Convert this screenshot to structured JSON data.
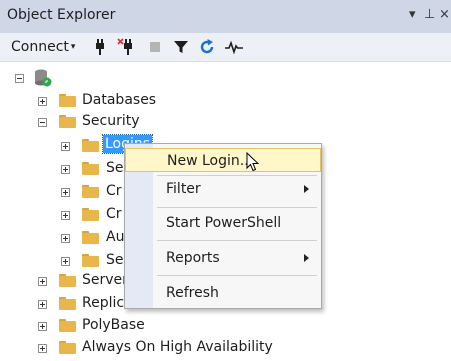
{
  "window": {
    "title": "Object Explorer",
    "dropdown_glyph": "▾",
    "pin_glyph": "⊥",
    "close_glyph": "×"
  },
  "toolbar": {
    "connect_label": "Connect",
    "connect_arrow": "▾",
    "icons": [
      "connect-plug-icon",
      "disconnect-plug-icon",
      "stop-icon",
      "filter-icon",
      "refresh-icon",
      "activity-monitor-icon"
    ]
  },
  "tree": {
    "items": [
      {
        "label": "Databases"
      },
      {
        "label": "Security"
      },
      {
        "label": "Logins"
      },
      {
        "label": "Se"
      },
      {
        "label": "Cr"
      },
      {
        "label": "Cr"
      },
      {
        "label": "Au"
      },
      {
        "label": "Se"
      },
      {
        "label": "Server"
      },
      {
        "label": "Replic"
      },
      {
        "label": "PolyBase"
      },
      {
        "label": "Always On High Availability"
      }
    ]
  },
  "context_menu": {
    "items": [
      {
        "label": "New Login..."
      },
      {
        "label": "Filter"
      },
      {
        "label": "Start PowerShell"
      },
      {
        "label": "Reports"
      },
      {
        "label": "Refresh"
      }
    ]
  },
  "colors": {
    "titlebar_bg": "#cfd6e5",
    "selection_bg": "#3399ff",
    "menu_highlight_bg": "#fff6c9",
    "folder": "#e8b64a"
  }
}
